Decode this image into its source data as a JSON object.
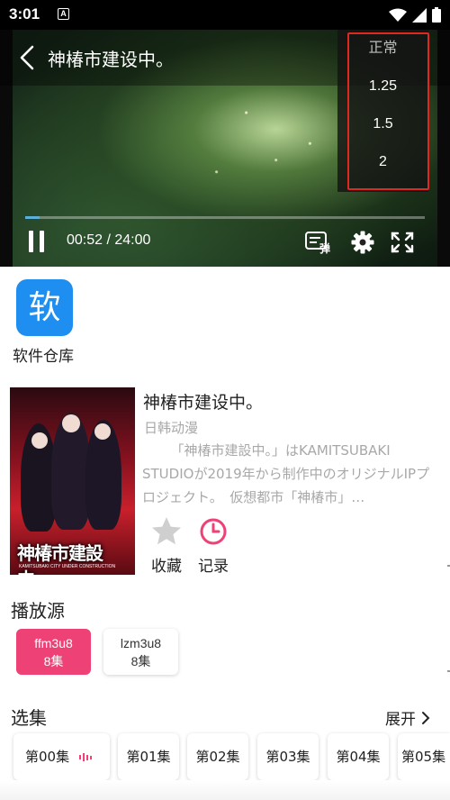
{
  "status_bar": {
    "time": "3:01",
    "notification_icon": "A",
    "icons": [
      "wifi-icon",
      "signal-icon",
      "battery-icon"
    ]
  },
  "player": {
    "title": "神椿市建设中。",
    "time_display": "00:52 / 24:00",
    "progress": 0.036,
    "danmaku_label": "弹",
    "speed_menu": {
      "options": [
        "正常",
        "1.25",
        "1.5",
        "2"
      ],
      "selected": "正常",
      "highlight_color": "#e0281e"
    }
  },
  "app_shortcut": {
    "glyph": "软",
    "label": "软件仓库",
    "color": "#1f8ef1"
  },
  "info": {
    "poster_title": "神椿市建設中。",
    "poster_subtitle": "KAMITSUBAKI CITY UNDER CONSTRUCTION",
    "title": "神椿市建设中。",
    "genre": "日韩动漫",
    "description": "「神椿市建設中。」はKAMITSUBAKI STUDIOが2019年から制作中のオリジナルIPプロジェクト。　仮想都市「神椿市」…",
    "actions": [
      {
        "label": "收藏",
        "icon": "star-icon"
      },
      {
        "label": "记录",
        "icon": "clock-icon"
      }
    ]
  },
  "sources": {
    "title": "播放源",
    "items": [
      {
        "name": "ffm3u8",
        "count": "8集",
        "active": true
      },
      {
        "name": "lzm3u8",
        "count": "8集",
        "active": false
      }
    ]
  },
  "episodes": {
    "title": "选集",
    "expand_label": "展开",
    "items": [
      "第00集",
      "第01集",
      "第02集",
      "第03集",
      "第04集",
      "第05集"
    ],
    "playing_index": 0
  },
  "colors": {
    "accent": "#ee4277",
    "progress": "#5ab0d8",
    "app_blue": "#1f8ef1"
  }
}
